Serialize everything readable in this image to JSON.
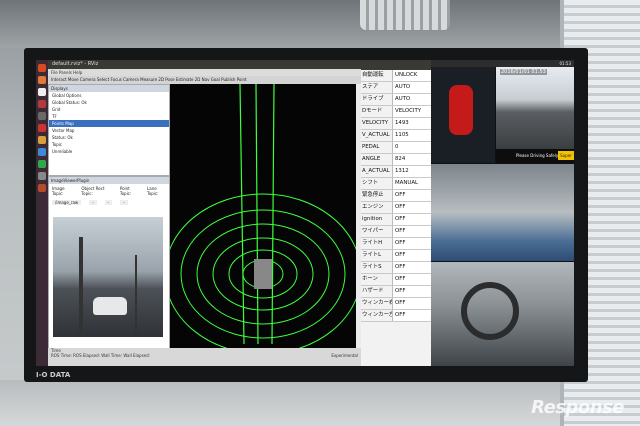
{
  "watermark": "Response",
  "monitor": {
    "brand": "I-O DATA"
  },
  "rviz": {
    "title": "default.rviz* - RViz",
    "menu": "File  Panels  Help",
    "toolbar": "Interact  Move Camera  Select  Focus Camera  Measure  2D Pose Estimate  2D Nav Goal  Publish Point",
    "displays": {
      "header": "Displays",
      "rows": [
        "Global Options",
        "Global Status: Ok",
        "Grid",
        "TF",
        "Points Map",
        "Vector Map",
        "Status: Ok",
        "Topic",
        "Unreliable"
      ]
    },
    "image_panel": {
      "header": "ImageViewerPlugin",
      "topics": [
        "Image Topic:",
        "Object Rect Topic:",
        "Point Topic:",
        "Lane Topic:"
      ],
      "image_topic": "/image_raw",
      "rect_topic": "-",
      "point_topic": "-",
      "lane_topic": "-"
    },
    "status": {
      "time_label": "Time",
      "ros_time": "ROS Time:",
      "ros_elapsed": "ROS Elapsed:",
      "wall_time": "Wall Time:",
      "wall_elapsed": "Wall Elapsed:",
      "experimental": "Experimental"
    }
  },
  "status_table": {
    "rows": [
      {
        "k": "自動運転",
        "v": "UNLOCK"
      },
      {
        "k": "ステア",
        "v": "AUTO"
      },
      {
        "k": "ドライブ",
        "v": "AUTO"
      },
      {
        "k": "Dモード",
        "v": "VELOCITY"
      },
      {
        "k": "VELOCITY",
        "v": "1493"
      },
      {
        "k": "V_ACTUAL",
        "v": "1105"
      },
      {
        "k": "PEDAL",
        "v": "0"
      },
      {
        "k": "ANGLE",
        "v": "824"
      },
      {
        "k": "A_ACTUAL",
        "v": "1312"
      },
      {
        "k": "シフト",
        "v": "MANUAL"
      },
      {
        "k": "緊急停止",
        "v": "OFF"
      },
      {
        "k": "エンジン",
        "v": "OFF"
      },
      {
        "k": "ignition",
        "v": "OFF"
      },
      {
        "k": "ワイパー",
        "v": "OFF"
      },
      {
        "k": "ライトH",
        "v": "OFF"
      },
      {
        "k": "ライトL",
        "v": "OFF"
      },
      {
        "k": "ライトS",
        "v": "OFF"
      },
      {
        "k": "ホーン",
        "v": "OFF"
      },
      {
        "k": "ハザード",
        "v": "OFF"
      },
      {
        "k": "ウィンカー右",
        "v": "OFF"
      },
      {
        "k": "ウィンカー左",
        "v": "OFF"
      }
    ]
  },
  "cams": {
    "clock": "01:53",
    "timestamp": "2016/01/01 01:53",
    "warning": "Please Driving Safely!",
    "super_label": "Super"
  },
  "colors": {
    "lidar": "#3dff3d",
    "bird_car": "#c41a1a",
    "super_badge": "#f2c200"
  }
}
